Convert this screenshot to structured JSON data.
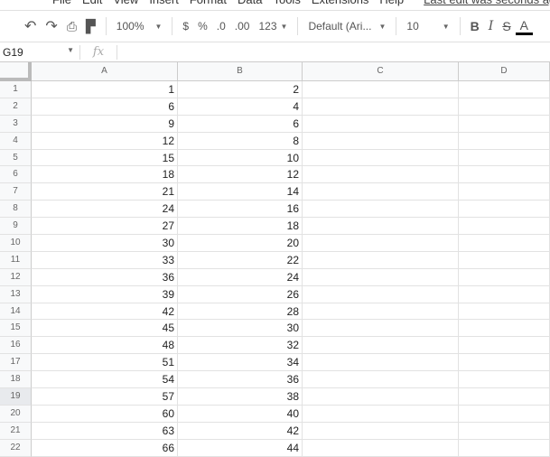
{
  "menu": {
    "items": [
      "File",
      "Edit",
      "View",
      "Insert",
      "Format",
      "Data",
      "Tools",
      "Extensions",
      "Help"
    ],
    "last_edit": "Last edit was seconds ago"
  },
  "toolbar": {
    "zoom": "100%",
    "currency": "$",
    "percent": "%",
    "decrease_decimal": ".0",
    "increase_decimal": ".00",
    "format": "123",
    "font": "Default (Ari...",
    "font_size": "10",
    "bold": "B",
    "italic": "I",
    "strike": "S",
    "text_color": "A"
  },
  "formula_bar": {
    "cell_ref": "G19",
    "fx": "fx",
    "value": ""
  },
  "columns": [
    "A",
    "B",
    "C",
    "D"
  ],
  "selected_row": 19,
  "rows": [
    {
      "n": "1",
      "a": "1",
      "b": "2"
    },
    {
      "n": "2",
      "a": "6",
      "b": "4"
    },
    {
      "n": "3",
      "a": "9",
      "b": "6"
    },
    {
      "n": "4",
      "a": "12",
      "b": "8"
    },
    {
      "n": "5",
      "a": "15",
      "b": "10"
    },
    {
      "n": "6",
      "a": "18",
      "b": "12"
    },
    {
      "n": "7",
      "a": "21",
      "b": "14"
    },
    {
      "n": "8",
      "a": "24",
      "b": "16"
    },
    {
      "n": "9",
      "a": "27",
      "b": "18"
    },
    {
      "n": "10",
      "a": "30",
      "b": "20"
    },
    {
      "n": "11",
      "a": "33",
      "b": "22"
    },
    {
      "n": "12",
      "a": "36",
      "b": "24"
    },
    {
      "n": "13",
      "a": "39",
      "b": "26"
    },
    {
      "n": "14",
      "a": "42",
      "b": "28"
    },
    {
      "n": "15",
      "a": "45",
      "b": "30"
    },
    {
      "n": "16",
      "a": "48",
      "b": "32"
    },
    {
      "n": "17",
      "a": "51",
      "b": "34"
    },
    {
      "n": "18",
      "a": "54",
      "b": "36"
    },
    {
      "n": "19",
      "a": "57",
      "b": "38"
    },
    {
      "n": "20",
      "a": "60",
      "b": "40"
    },
    {
      "n": "21",
      "a": "63",
      "b": "42"
    },
    {
      "n": "22",
      "a": "66",
      "b": "44"
    }
  ]
}
